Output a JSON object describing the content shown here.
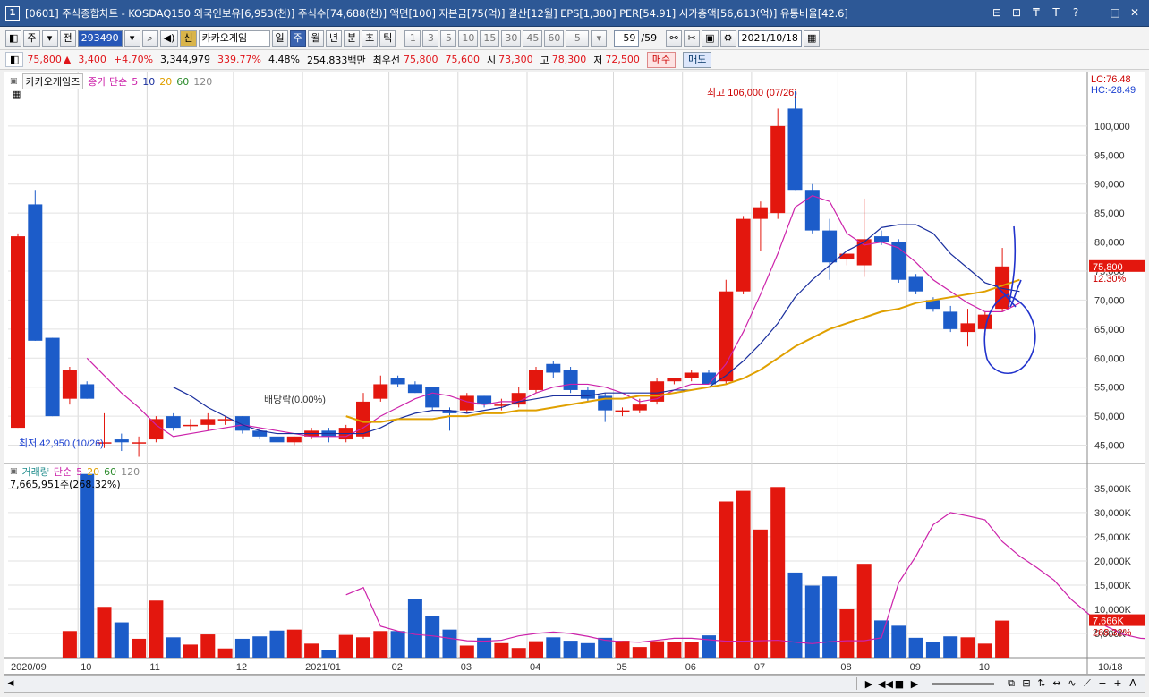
{
  "window": {
    "title": "[0601] 주식종합차트 - KOSDAQ150 외국인보유[6,953(천)] 주식수[74,688(천)] 액면[100] 자본금[75(억)] 결산[12월] EPS[1,380] PER[54.91] 시가총액[56,613(억)] 유통비율[42.6]",
    "app_icon": "1",
    "buttons": [
      "⊟",
      "⊡",
      "₸",
      "T",
      "?",
      "—",
      "□",
      "✕"
    ]
  },
  "toolbar": {
    "period_select": "주",
    "jeon_label": "전",
    "code": "293490",
    "shin_label": "신",
    "stock_name": "카카오게임",
    "periods": [
      "일",
      "주",
      "월",
      "년",
      "분",
      "초",
      "틱"
    ],
    "active_period": "주",
    "intervals": [
      "1",
      "3",
      "5",
      "10",
      "15",
      "30",
      "45",
      "60"
    ],
    "interval_value": "5",
    "count": "59",
    "count_total": "/59",
    "date": "2021/10/18"
  },
  "quote": {
    "price": "75,800",
    "arrow": "▲",
    "change": "3,400",
    "change_pct": "+4.70%",
    "volume": "3,344,979",
    "volume_ratio": "339.77%",
    "turnover": "4.48%",
    "amount": "254,833백만",
    "best_label": "최우선",
    "best_ask": "75,800",
    "best_bid": "75,600",
    "open_label": "시",
    "open": "73,300",
    "high_label": "고",
    "high": "78,300",
    "low_label": "저",
    "low": "72,500",
    "buy_label": "매수",
    "sell_label": "매도"
  },
  "price_panel": {
    "stock_label": "카카오게임즈",
    "ma_label": "종가 단순",
    "ma_periods": [
      "5",
      "10",
      "20",
      "60",
      "120"
    ],
    "lc": "LC:76.48",
    "hc": "HC:-28.49",
    "high_note": "최고 106,000 (07/26)",
    "low_note": "최저 42,950 (10/26)",
    "dividend_note": "배당락(0.00%)",
    "current_tag": "75,800",
    "current_pct": "12.30%",
    "y_ticks": [
      "100,000",
      "95,000",
      "90,000",
      "85,000",
      "80,000",
      "75,000",
      "70,000",
      "65,000",
      "60,000",
      "55,000",
      "50,000",
      "45,000"
    ]
  },
  "volume_panel": {
    "label": "거래량",
    "ma_label": "단순",
    "ma_periods": [
      "5",
      "20",
      "60",
      "120"
    ],
    "value_text": "7,665,951주(268.32%)",
    "current_tag": "7,666K",
    "current_pct": "268.32%",
    "y_ticks": [
      "35,000K",
      "30,000K",
      "25,000K",
      "20,000K",
      "15,000K",
      "10,000K",
      "5,000K"
    ]
  },
  "x_axis": [
    "2020/09",
    "10",
    "11",
    "12",
    "2021/01",
    "02",
    "03",
    "04",
    "05",
    "06",
    "07",
    "08",
    "09",
    "10",
    "10/18"
  ],
  "colors": {
    "up": "#e3170e",
    "down": "#1c5cc9",
    "ma5": "#cc22aa",
    "ma10": "#1a2f9e",
    "ma20": "#e0a000",
    "title": "#2d5896"
  },
  "chart_data": {
    "type": "candlestick",
    "title": "카카오게임즈",
    "y_range": [
      42000,
      108000
    ],
    "candles": [
      {
        "o": 48000,
        "h": 81500,
        "l": 48000,
        "c": 81000
      },
      {
        "o": 86500,
        "h": 89000,
        "l": 63000,
        "c": 63000
      },
      {
        "o": 63500,
        "h": 63500,
        "l": 50000,
        "c": 50000
      },
      {
        "o": 53000,
        "h": 58500,
        "l": 52000,
        "c": 58000
      },
      {
        "o": 55500,
        "h": 56000,
        "l": 53000,
        "c": 53000
      },
      {
        "o": 45500,
        "h": 50500,
        "l": 44500,
        "c": 45500
      },
      {
        "o": 46000,
        "h": 47000,
        "l": 44000,
        "c": 45500
      },
      {
        "o": 45500,
        "h": 46500,
        "l": 43000,
        "c": 45500
      },
      {
        "o": 46000,
        "h": 50000,
        "l": 45500,
        "c": 49500
      },
      {
        "o": 50000,
        "h": 50500,
        "l": 47500,
        "c": 48000
      },
      {
        "o": 48500,
        "h": 49500,
        "l": 47500,
        "c": 48500
      },
      {
        "o": 48500,
        "h": 50500,
        "l": 47500,
        "c": 49500
      },
      {
        "o": 49500,
        "h": 50000,
        "l": 48500,
        "c": 49500
      },
      {
        "o": 50000,
        "h": 50000,
        "l": 47000,
        "c": 47500
      },
      {
        "o": 47500,
        "h": 48000,
        "l": 46000,
        "c": 46500
      },
      {
        "o": 46500,
        "h": 47000,
        "l": 45000,
        "c": 45500
      },
      {
        "o": 45500,
        "h": 46500,
        "l": 45000,
        "c": 46500
      },
      {
        "o": 46500,
        "h": 48000,
        "l": 46000,
        "c": 47500
      },
      {
        "o": 47500,
        "h": 48000,
        "l": 45500,
        "c": 46500
      },
      {
        "o": 46000,
        "h": 48500,
        "l": 45500,
        "c": 48000
      },
      {
        "o": 46500,
        "h": 54000,
        "l": 46000,
        "c": 52500
      },
      {
        "o": 53000,
        "h": 57000,
        "l": 52500,
        "c": 55500
      },
      {
        "o": 56500,
        "h": 57000,
        "l": 55000,
        "c": 55500
      },
      {
        "o": 55500,
        "h": 56000,
        "l": 54000,
        "c": 54000
      },
      {
        "o": 55000,
        "h": 55000,
        "l": 51000,
        "c": 51500
      },
      {
        "o": 51000,
        "h": 51500,
        "l": 47500,
        "c": 50500
      },
      {
        "o": 51000,
        "h": 54000,
        "l": 50500,
        "c": 53500
      },
      {
        "o": 53500,
        "h": 53500,
        "l": 51500,
        "c": 52000
      },
      {
        "o": 52000,
        "h": 53000,
        "l": 51000,
        "c": 52000
      },
      {
        "o": 52000,
        "h": 55000,
        "l": 51500,
        "c": 54000
      },
      {
        "o": 54500,
        "h": 58500,
        "l": 54000,
        "c": 58000
      },
      {
        "o": 59000,
        "h": 59500,
        "l": 56500,
        "c": 57500
      },
      {
        "o": 58000,
        "h": 58500,
        "l": 54000,
        "c": 54500
      },
      {
        "o": 54500,
        "h": 55000,
        "l": 52500,
        "c": 53000
      },
      {
        "o": 53500,
        "h": 54000,
        "l": 49000,
        "c": 51000
      },
      {
        "o": 51000,
        "h": 51500,
        "l": 50000,
        "c": 51000
      },
      {
        "o": 51000,
        "h": 53000,
        "l": 50500,
        "c": 52000
      },
      {
        "o": 52500,
        "h": 56500,
        "l": 52000,
        "c": 56000
      },
      {
        "o": 56000,
        "h": 56500,
        "l": 55500,
        "c": 56500
      },
      {
        "o": 56500,
        "h": 58000,
        "l": 56000,
        "c": 57500
      },
      {
        "o": 57500,
        "h": 58000,
        "l": 55500,
        "c": 55500
      },
      {
        "o": 56000,
        "h": 73500,
        "l": 55500,
        "c": 71500
      },
      {
        "o": 71500,
        "h": 84500,
        "l": 71000,
        "c": 84000
      },
      {
        "o": 84000,
        "h": 87000,
        "l": 78500,
        "c": 86000
      },
      {
        "o": 85000,
        "h": 103000,
        "l": 84000,
        "c": 100000
      },
      {
        "o": 103000,
        "h": 106000,
        "l": 89000,
        "c": 89000
      },
      {
        "o": 89000,
        "h": 90000,
        "l": 81500,
        "c": 82000
      },
      {
        "o": 82000,
        "h": 84000,
        "l": 73500,
        "c": 76500
      },
      {
        "o": 77000,
        "h": 78000,
        "l": 76000,
        "c": 78000
      },
      {
        "o": 76000,
        "h": 87500,
        "l": 74000,
        "c": 80500
      },
      {
        "o": 81000,
        "h": 82000,
        "l": 79500,
        "c": 80000
      },
      {
        "o": 80000,
        "h": 80500,
        "l": 73000,
        "c": 73500
      },
      {
        "o": 74000,
        "h": 74500,
        "l": 71000,
        "c": 71500
      },
      {
        "o": 70000,
        "h": 70500,
        "l": 68000,
        "c": 68500
      },
      {
        "o": 68000,
        "h": 69000,
        "l": 64500,
        "c": 65000
      },
      {
        "o": 64500,
        "h": 68500,
        "l": 62000,
        "c": 66000
      },
      {
        "o": 65000,
        "h": 68000,
        "l": 64000,
        "c": 67500
      },
      {
        "o": 68500,
        "h": 79000,
        "l": 68000,
        "c": 75800
      }
    ],
    "volume_k": [
      5500,
      38000,
      10500,
      7300,
      3900,
      11800,
      4200,
      2700,
      4800,
      1900,
      3900,
      4400,
      5600,
      5800,
      2900,
      1600,
      4700,
      4200,
      5500,
      5500,
      12100,
      8600,
      5800,
      2500,
      4100,
      3000,
      2000,
      3400,
      4200,
      3500,
      3000,
      4100,
      3500,
      2200,
      3400,
      3300,
      3200,
      4600,
      32300,
      34500,
      26500,
      35300,
      17600,
      14900,
      16800,
      10000,
      19400,
      7700,
      6600,
      4100,
      3200,
      4400,
      4200,
      2900,
      7666
    ],
    "ma5": [
      null,
      null,
      null,
      null,
      60000,
      57000,
      54000,
      51500,
      48500,
      46500,
      47000,
      47500,
      48000,
      48500,
      48000,
      47500,
      47000,
      46500,
      46500,
      46500,
      48000,
      50000,
      51500,
      53000,
      54000,
      53500,
      52500,
      52000,
      52500,
      52500,
      54000,
      55000,
      55500,
      55500,
      55000,
      54000,
      52500,
      53000,
      54500,
      55500,
      55500,
      59000,
      64500,
      71000,
      78000,
      86000,
      88000,
      87000,
      81500,
      79500,
      80000,
      79000,
      76500,
      73500,
      71500,
      69500,
      68000,
      68000,
      69500
    ],
    "ma10": [
      null,
      null,
      null,
      null,
      null,
      null,
      null,
      null,
      null,
      55000,
      53500,
      51500,
      50000,
      48500,
      47500,
      47000,
      47000,
      47000,
      47000,
      47000,
      47000,
      48000,
      49500,
      50500,
      51000,
      51000,
      50500,
      51000,
      51500,
      52500,
      53000,
      53500,
      53500,
      53500,
      54000,
      54000,
      54000,
      54000,
      54500,
      54500,
      55000,
      57000,
      59500,
      62500,
      66000,
      70500,
      73500,
      76000,
      78500,
      80000,
      82500,
      83000,
      83000,
      81500,
      78000,
      75500,
      73000,
      72000,
      71500
    ],
    "ma20": [
      null,
      null,
      null,
      null,
      null,
      null,
      null,
      null,
      null,
      null,
      null,
      null,
      null,
      null,
      null,
      null,
      null,
      null,
      null,
      50000,
      49000,
      49000,
      49500,
      49500,
      49500,
      50000,
      50000,
      50500,
      50500,
      51000,
      51000,
      51500,
      52000,
      52500,
      53000,
      53000,
      53500,
      53500,
      54000,
      54500,
      55000,
      55500,
      56500,
      58000,
      60000,
      62000,
      63500,
      65000,
      66000,
      67000,
      68000,
      68500,
      69500,
      70000,
      70500,
      71000,
      71500,
      72500,
      73500
    ],
    "vol_ma5": [
      null,
      null,
      null,
      null,
      null,
      null,
      null,
      null,
      null,
      null,
      null,
      null,
      null,
      null,
      null,
      null,
      13000,
      14500,
      6500,
      5500,
      4800,
      4500,
      4000,
      3500,
      3400,
      3600,
      4500,
      5000,
      5300,
      5000,
      4400,
      3600,
      3300,
      3200,
      3600,
      4000,
      4000,
      3700,
      3400,
      3400,
      3500,
      3600,
      3200,
      2900,
      3300,
      3500,
      3500,
      4100,
      15500,
      21000,
      27500,
      30000,
      29300,
      28500,
      24000,
      21000,
      18600,
      16000,
      12000,
      9000,
      6500,
      4800,
      4000,
      3800,
      3600,
      5000
    ]
  }
}
